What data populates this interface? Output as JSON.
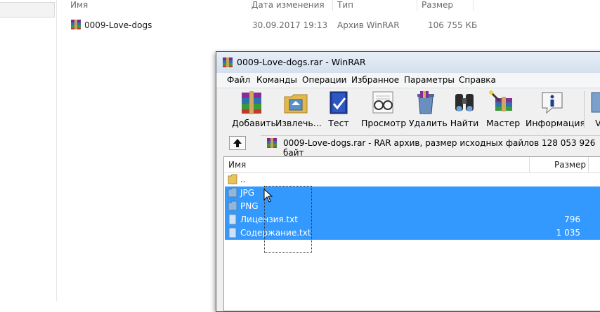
{
  "explorer": {
    "columns": {
      "name": "Имя",
      "date": "Дата изменения",
      "type": "Тип",
      "size": "Размер"
    },
    "file": {
      "name": "0009-Love-dogs",
      "date": "30.09.2017 19:13",
      "type": "Архив WinRAR",
      "size": "106 755 КБ"
    }
  },
  "winrar": {
    "title": "0009-Love-dogs.rar - WinRAR",
    "menu": [
      "Файл",
      "Команды",
      "Операции",
      "Избранное",
      "Параметры",
      "Справка"
    ],
    "toolbar": {
      "add": "Добавить",
      "extract": "Извлечь...",
      "test": "Тест",
      "view": "Просмотр",
      "delete": "Удалить",
      "find": "Найти",
      "wizard": "Мастер",
      "info": "Информация",
      "more": "Vi"
    },
    "address": "0009-Love-dogs.rar - RAR архив, размер исходных файлов 128 053 926 байт",
    "list": {
      "col_name": "Имя",
      "col_size": "Размер",
      "rows": [
        {
          "name": "..",
          "size": "",
          "icon": "folder-up-icon",
          "selected": false
        },
        {
          "name": "JPG",
          "size": "",
          "icon": "folder-icon",
          "selected": true
        },
        {
          "name": "PNG",
          "size": "",
          "icon": "folder-icon",
          "selected": true
        },
        {
          "name": "Лицензия.txt",
          "size": "796",
          "icon": "text-file-icon",
          "selected": true
        },
        {
          "name": "Содержание.txt",
          "size": "1 035",
          "icon": "text-file-icon",
          "selected": true
        }
      ]
    }
  },
  "colors": {
    "selection": "#3399ff",
    "title_bg": "#dce6f2",
    "window_bg": "#f0f0f0"
  }
}
